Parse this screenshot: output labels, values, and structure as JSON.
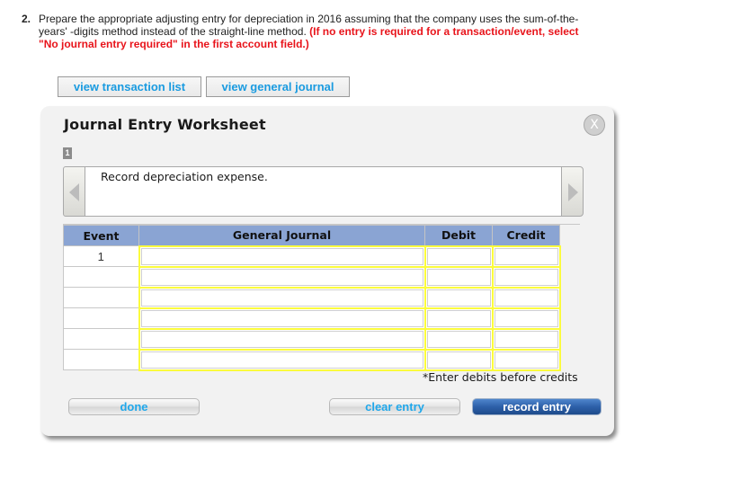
{
  "question": {
    "number": "2.",
    "text": "Prepare the appropriate adjusting entry for depreciation in 2016 assuming that the company uses the sum-of-the-years' -digits method instead of the straight-line method.",
    "hint": "(If no entry is required for a transaction/event, select \"No journal entry required\" in the first account field.)"
  },
  "top_buttons": {
    "view_transaction_list": "view transaction list",
    "view_general_journal": "view general journal"
  },
  "worksheet": {
    "title": "Journal Entry Worksheet",
    "close_label": "X",
    "step_number": "1",
    "description": "Record depreciation expense.",
    "columns": {
      "event": "Event",
      "general_journal": "General Journal",
      "debit": "Debit",
      "credit": "Credit"
    },
    "rows": [
      {
        "event": "1",
        "account": "",
        "debit": "",
        "credit": ""
      },
      {
        "event": "",
        "account": "",
        "debit": "",
        "credit": ""
      },
      {
        "event": "",
        "account": "",
        "debit": "",
        "credit": ""
      },
      {
        "event": "",
        "account": "",
        "debit": "",
        "credit": ""
      },
      {
        "event": "",
        "account": "",
        "debit": "",
        "credit": ""
      },
      {
        "event": "",
        "account": "",
        "debit": "",
        "credit": ""
      }
    ],
    "note": "*Enter debits before credits",
    "buttons": {
      "done": "done",
      "clear_entry": "clear entry",
      "record_entry": "record entry"
    }
  },
  "colors": {
    "hint_red": "#e8141b",
    "link_blue": "#1a9be0",
    "table_header": "#8aa4d3",
    "input_border_yellow": "#fbfb3d",
    "record_button": "#2d60a9"
  }
}
